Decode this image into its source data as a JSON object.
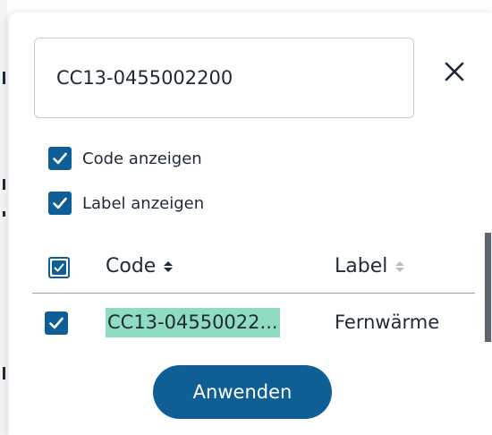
{
  "search": {
    "value": "CC13-0455002200"
  },
  "options": {
    "show_code_label": "Code anzeigen",
    "show_label_label": "Label anzeigen",
    "show_code_checked": true,
    "show_label_checked": true
  },
  "table": {
    "columns": [
      "Code",
      "Label"
    ],
    "rows": [
      {
        "code": "CC13-04550022...",
        "label": "Fernwärme",
        "checked": true,
        "highlighted": true
      }
    ]
  },
  "actions": {
    "apply_label": "Anwenden"
  },
  "colors": {
    "accent": "#0f5e96",
    "highlight": "#8fdcc1"
  },
  "icons": {
    "close": "close-icon",
    "check": "check-icon",
    "sort": "sort-icon"
  }
}
